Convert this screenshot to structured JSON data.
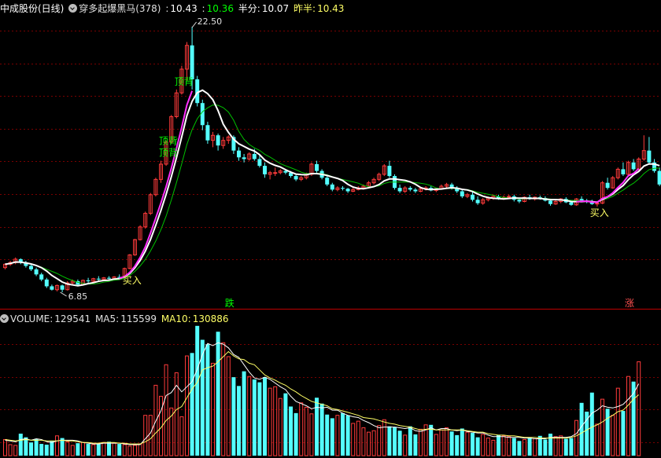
{
  "header": {
    "stock_name": "中成股份(日线)",
    "indicator_name": "穿多起爆黑马(378)",
    "v1_label": ":",
    "v1_value": "10.43",
    "v2_label": ":",
    "v2_value": "10.36",
    "half_label": "半分:",
    "half_value": "10.07",
    "prev_half_label": "昨半:",
    "prev_half_value": "10.43"
  },
  "volume_header": {
    "volume_label": "VOLUME:",
    "volume_value": "129541",
    "ma5_label": "MA5:",
    "ma5_value": "115599",
    "ma10_label": "MA10:",
    "ma10_value": "130886"
  },
  "colors": {
    "up": "#ff3b3b",
    "down": "#54ffff",
    "ma_white": "#ffffff",
    "ma_green": "#00c000",
    "ma_magenta": "#ff30ff",
    "volume_ma": "#ffff66",
    "grid": "#7a0000",
    "signal_buy": "#ffff66",
    "signal_top": "#00ff00"
  },
  "chart_data": {
    "type": "candlestick",
    "price_min": 6.85,
    "price_max": 22.5,
    "annotations": [
      {
        "label": "22.50",
        "value": 22.5
      },
      {
        "label": "6.85",
        "value": 6.85
      }
    ],
    "signals": [
      {
        "label": "买入",
        "kind": "buy"
      },
      {
        "label": "买入",
        "kind": "buy"
      },
      {
        "label": "顶背",
        "kind": "top"
      },
      {
        "label": "顶背",
        "kind": "top"
      },
      {
        "label": "顶背",
        "kind": "top"
      }
    ],
    "markers": [
      {
        "label": "跌",
        "kind": "down"
      },
      {
        "label": "涨",
        "kind": "up"
      }
    ],
    "candles": [
      [
        8.3,
        8.55,
        8.2,
        8.5
      ],
      [
        8.5,
        8.7,
        8.4,
        8.6
      ],
      [
        8.6,
        8.9,
        8.5,
        8.8
      ],
      [
        8.8,
        8.85,
        8.5,
        8.6
      ],
      [
        8.6,
        8.7,
        8.3,
        8.4
      ],
      [
        8.4,
        8.5,
        8.1,
        8.2
      ],
      [
        8.2,
        8.3,
        7.8,
        7.9
      ],
      [
        7.9,
        8.0,
        7.5,
        7.6
      ],
      [
        7.6,
        7.7,
        7.1,
        7.2
      ],
      [
        7.2,
        7.3,
        6.95,
        7.0
      ],
      [
        7.0,
        7.3,
        6.9,
        7.25
      ],
      [
        7.25,
        7.3,
        6.85,
        7.0
      ],
      [
        7.0,
        7.5,
        6.95,
        7.4
      ],
      [
        7.4,
        7.6,
        7.3,
        7.5
      ],
      [
        7.5,
        7.6,
        7.2,
        7.3
      ],
      [
        7.3,
        7.6,
        7.25,
        7.55
      ],
      [
        7.55,
        7.7,
        7.4,
        7.5
      ],
      [
        7.5,
        7.7,
        7.45,
        7.65
      ],
      [
        7.65,
        7.8,
        7.5,
        7.6
      ],
      [
        7.6,
        7.75,
        7.5,
        7.7
      ],
      [
        7.7,
        7.8,
        7.55,
        7.65
      ],
      [
        7.65,
        7.8,
        7.6,
        7.75
      ],
      [
        7.75,
        7.9,
        7.6,
        7.7
      ],
      [
        7.7,
        8.3,
        7.65,
        8.25
      ],
      [
        8.25,
        9.1,
        8.2,
        9.05
      ],
      [
        9.05,
        10.0,
        9.0,
        9.95
      ],
      [
        9.95,
        10.8,
        9.9,
        10.7
      ],
      [
        10.7,
        11.6,
        10.6,
        11.5
      ],
      [
        11.5,
        12.7,
        11.4,
        12.6
      ],
      [
        12.6,
        13.6,
        12.5,
        13.5
      ],
      [
        13.5,
        14.6,
        13.3,
        14.4
      ],
      [
        14.4,
        15.8,
        14.3,
        15.7
      ],
      [
        15.7,
        17.3,
        15.6,
        17.2
      ],
      [
        17.2,
        18.8,
        17.1,
        18.6
      ],
      [
        18.6,
        20.2,
        18.5,
        20.0
      ],
      [
        20.0,
        21.6,
        19.3,
        21.4
      ],
      [
        21.4,
        22.5,
        18.8,
        19.4
      ],
      [
        19.4,
        19.6,
        17.8,
        18.0
      ],
      [
        18.0,
        18.2,
        16.4,
        16.7
      ],
      [
        16.7,
        16.9,
        15.6,
        15.8
      ],
      [
        15.8,
        16.3,
        15.4,
        16.1
      ],
      [
        16.1,
        16.2,
        15.2,
        15.5
      ],
      [
        15.5,
        16.0,
        15.3,
        15.8
      ],
      [
        15.8,
        16.1,
        15.6,
        16.0
      ],
      [
        16.0,
        16.1,
        15.0,
        15.2
      ],
      [
        15.2,
        15.4,
        14.6,
        14.8
      ],
      [
        14.8,
        15.0,
        14.5,
        14.7
      ],
      [
        14.7,
        15.1,
        14.6,
        15.0
      ],
      [
        15.0,
        15.3,
        14.6,
        14.7
      ],
      [
        14.7,
        14.9,
        14.2,
        14.3
      ],
      [
        14.3,
        14.5,
        13.6,
        13.8
      ],
      [
        13.8,
        14.0,
        13.5,
        13.9
      ],
      [
        13.9,
        14.2,
        13.7,
        13.9
      ],
      [
        13.9,
        14.1,
        13.8,
        14.0
      ],
      [
        14.0,
        14.1,
        13.8,
        13.9
      ],
      [
        13.9,
        14.0,
        13.6,
        13.7
      ],
      [
        13.7,
        13.8,
        13.4,
        13.5
      ],
      [
        13.5,
        13.7,
        13.4,
        13.6
      ],
      [
        13.6,
        13.9,
        13.5,
        13.8
      ],
      [
        13.8,
        14.5,
        13.7,
        14.4
      ],
      [
        14.4,
        14.6,
        13.9,
        14.0
      ],
      [
        14.0,
        14.1,
        13.5,
        13.6
      ],
      [
        13.6,
        13.7,
        13.1,
        13.2
      ],
      [
        13.2,
        13.3,
        12.8,
        12.9
      ],
      [
        12.9,
        13.1,
        12.8,
        13.0
      ],
      [
        13.0,
        13.1,
        12.85,
        12.95
      ],
      [
        12.95,
        13.0,
        12.7,
        12.8
      ],
      [
        12.8,
        13.0,
        12.75,
        12.9
      ],
      [
        12.9,
        13.1,
        12.85,
        13.0
      ],
      [
        13.0,
        13.2,
        12.9,
        13.1
      ],
      [
        13.1,
        13.4,
        13.0,
        13.3
      ],
      [
        13.3,
        13.6,
        13.2,
        13.5
      ],
      [
        13.5,
        13.9,
        13.4,
        13.8
      ],
      [
        13.8,
        14.4,
        13.7,
        14.3
      ],
      [
        14.3,
        14.6,
        13.6,
        13.7
      ],
      [
        13.7,
        13.8,
        12.9,
        13.0
      ],
      [
        13.0,
        13.2,
        12.7,
        12.8
      ],
      [
        12.8,
        13.1,
        12.7,
        13.0
      ],
      [
        13.0,
        13.1,
        12.8,
        12.9
      ],
      [
        12.9,
        13.0,
        12.7,
        12.8
      ],
      [
        12.8,
        13.0,
        12.75,
        12.95
      ],
      [
        12.95,
        13.1,
        12.85,
        13.0
      ],
      [
        13.0,
        13.1,
        12.8,
        12.85
      ],
      [
        12.85,
        13.0,
        12.75,
        12.95
      ],
      [
        12.95,
        13.2,
        12.9,
        13.1
      ],
      [
        13.1,
        13.3,
        13.0,
        13.2
      ],
      [
        13.2,
        13.3,
        12.9,
        13.0
      ],
      [
        13.0,
        13.1,
        12.7,
        12.8
      ],
      [
        12.8,
        12.9,
        12.4,
        12.5
      ],
      [
        12.5,
        12.7,
        12.4,
        12.6
      ],
      [
        12.6,
        12.8,
        12.2,
        12.3
      ],
      [
        12.3,
        12.5,
        12.0,
        12.1
      ],
      [
        12.1,
        12.4,
        12.0,
        12.3
      ],
      [
        12.3,
        12.5,
        12.2,
        12.4
      ],
      [
        12.4,
        12.6,
        12.3,
        12.5
      ],
      [
        12.5,
        12.6,
        12.3,
        12.4
      ],
      [
        12.4,
        12.55,
        12.3,
        12.45
      ],
      [
        12.45,
        12.6,
        12.35,
        12.5
      ],
      [
        12.5,
        12.6,
        12.2,
        12.3
      ],
      [
        12.3,
        12.4,
        12.1,
        12.2
      ],
      [
        12.2,
        12.5,
        12.15,
        12.45
      ],
      [
        12.45,
        12.6,
        12.3,
        12.35
      ],
      [
        12.35,
        12.5,
        12.25,
        12.45
      ],
      [
        12.45,
        12.55,
        12.3,
        12.4
      ],
      [
        12.4,
        12.5,
        12.2,
        12.25
      ],
      [
        12.25,
        12.35,
        11.95,
        12.05
      ],
      [
        12.05,
        12.3,
        12.0,
        12.2
      ],
      [
        12.2,
        12.4,
        12.1,
        12.35
      ],
      [
        12.35,
        12.45,
        12.1,
        12.15
      ],
      [
        12.15,
        12.25,
        11.95,
        12.0
      ],
      [
        12.0,
        12.4,
        11.95,
        12.35
      ],
      [
        12.35,
        12.5,
        12.2,
        12.25
      ],
      [
        12.25,
        12.35,
        12.1,
        12.2
      ],
      [
        12.2,
        12.3,
        12.0,
        12.05
      ],
      [
        12.05,
        12.2,
        11.9,
        12.1
      ],
      [
        12.1,
        13.4,
        12.05,
        13.3
      ],
      [
        13.3,
        13.6,
        12.9,
        13.0
      ],
      [
        13.0,
        13.7,
        12.95,
        13.6
      ],
      [
        13.6,
        14.2,
        13.5,
        14.1
      ],
      [
        14.1,
        14.5,
        13.7,
        13.8
      ],
      [
        13.8,
        14.6,
        13.7,
        14.5
      ],
      [
        14.5,
        14.7,
        14.0,
        14.1
      ],
      [
        14.1,
        14.8,
        14.0,
        14.7
      ],
      [
        14.7,
        16.1,
        14.6,
        15.2
      ],
      [
        15.2,
        16.0,
        14.4,
        14.5
      ],
      [
        14.5,
        14.7,
        13.9,
        14.0
      ],
      [
        14.0,
        14.2,
        13.1,
        13.2
      ]
    ],
    "volume": [
      22,
      15,
      14,
      30,
      25,
      18,
      23,
      16,
      15,
      20,
      27,
      24,
      19,
      14,
      17,
      18,
      16,
      15,
      16,
      18,
      19,
      17,
      16,
      15,
      13,
      14,
      16,
      55,
      55,
      96,
      81,
      124,
      65,
      113,
      53,
      136,
      140,
      177,
      158,
      152,
      126,
      169,
      154,
      135,
      107,
      95,
      115,
      108,
      104,
      100,
      107,
      92,
      94,
      78,
      85,
      67,
      58,
      72,
      66,
      57,
      79,
      71,
      56,
      51,
      55,
      58,
      55,
      44,
      47,
      38,
      32,
      34,
      41,
      49,
      40,
      39,
      34,
      28,
      40,
      29,
      36,
      42,
      42,
      29,
      35,
      38,
      33,
      28,
      37,
      32,
      31,
      25,
      29,
      24,
      21,
      28,
      27,
      26,
      24,
      20,
      22,
      25,
      23,
      27,
      22,
      30,
      26,
      27,
      23,
      24,
      48,
      72,
      60,
      86,
      43,
      77,
      64,
      55,
      92,
      61,
      108,
      101,
      128
    ],
    "volume_ma5": [
      21,
      20,
      19,
      22,
      23,
      21,
      23,
      22,
      19,
      18,
      20,
      21,
      21,
      21,
      20,
      18,
      17,
      16,
      16,
      17,
      17,
      17,
      17,
      16,
      15,
      15,
      15,
      23,
      31,
      47,
      61,
      82,
      86,
      96,
      87,
      94,
      101,
      118,
      138,
      153,
      150,
      154,
      152,
      147,
      138,
      134,
      124,
      114,
      106,
      104,
      107,
      104,
      99,
      94,
      90,
      81,
      74,
      71,
      68,
      64,
      66,
      65,
      66,
      62,
      62,
      58,
      55,
      53,
      52,
      48,
      45,
      41,
      38,
      39,
      39,
      39,
      38,
      37,
      38,
      34,
      33,
      35,
      38,
      35,
      37,
      37,
      35,
      34,
      35,
      33,
      32,
      31,
      31,
      28,
      26,
      26,
      26,
      25,
      25,
      25,
      24,
      24,
      23,
      23,
      23,
      25,
      25,
      25,
      25,
      26,
      30,
      40,
      49,
      58,
      62,
      68,
      66,
      65,
      67,
      70,
      77,
      85,
      98
    ],
    "volume_ma10": [
      22,
      21,
      20,
      21,
      22,
      21,
      21,
      21,
      20,
      20,
      20,
      21,
      20,
      20,
      19,
      18,
      18,
      17,
      17,
      18,
      18,
      18,
      17,
      17,
      16,
      16,
      16,
      19,
      23,
      31,
      38,
      48,
      54,
      63,
      67,
      79,
      91,
      100,
      117,
      120,
      122,
      128,
      135,
      142,
      136,
      132,
      131,
      126,
      124,
      117,
      110,
      106,
      103,
      99,
      96,
      91,
      87,
      82,
      78,
      74,
      72,
      70,
      68,
      64,
      63,
      61,
      59,
      57,
      55,
      52,
      51,
      50,
      48,
      46,
      44,
      43,
      41,
      40,
      39,
      37,
      35,
      36,
      36,
      35,
      35,
      35,
      35,
      35,
      35,
      34,
      33,
      32,
      32,
      30,
      29,
      28,
      28,
      27,
      27,
      26,
      25,
      25,
      25,
      24,
      24,
      24,
      24,
      24,
      24,
      25,
      27,
      31,
      35,
      39,
      42,
      46,
      51,
      55,
      60,
      62,
      69,
      77,
      83
    ]
  }
}
